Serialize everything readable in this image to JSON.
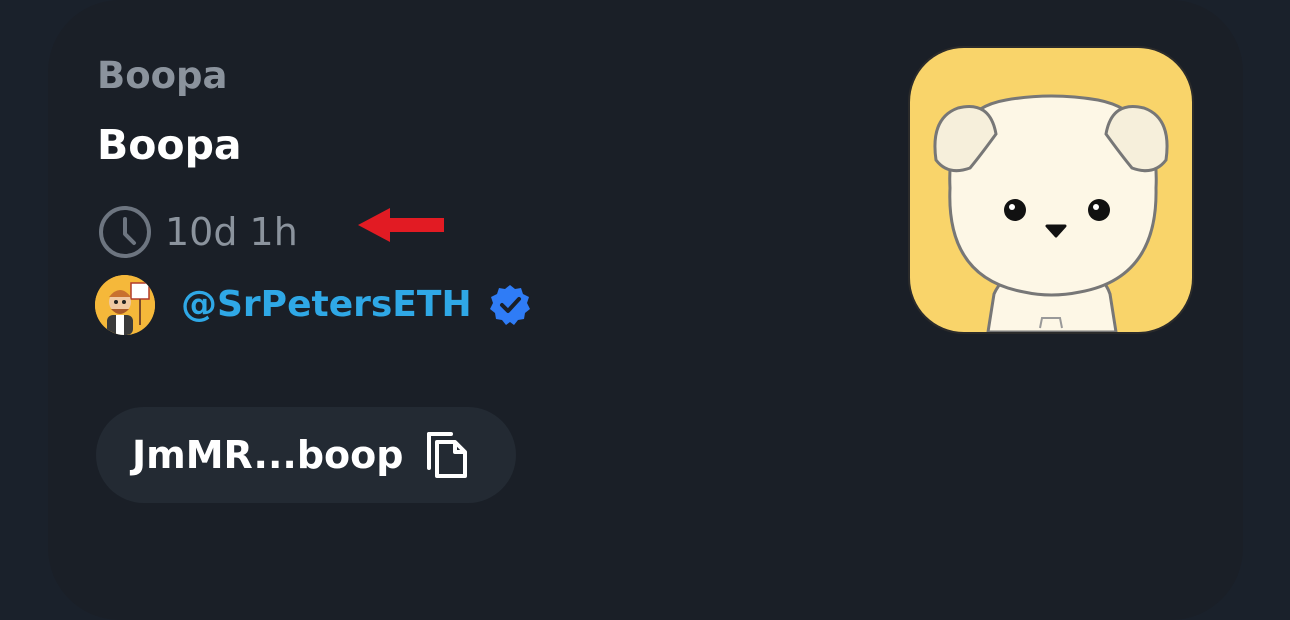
{
  "token": {
    "ticker": "Boopa",
    "name": "Boopa",
    "age": "10d 1h",
    "image_icon": "puppy-logo"
  },
  "creator": {
    "handle": "@SrPetersETH",
    "verified": true,
    "avatar_icon": "creator-avatar"
  },
  "address": {
    "short": "JmMR...boop",
    "copy_icon": "copy-icon"
  },
  "colors": {
    "card_bg": "#1a1f27",
    "muted_text": "#8b939d",
    "handle": "#2fa8e6",
    "verified": "#2f7cf6",
    "pill_bg": "#232a33",
    "arrow": "#e21b23",
    "image_bg": "#f9d46a"
  }
}
